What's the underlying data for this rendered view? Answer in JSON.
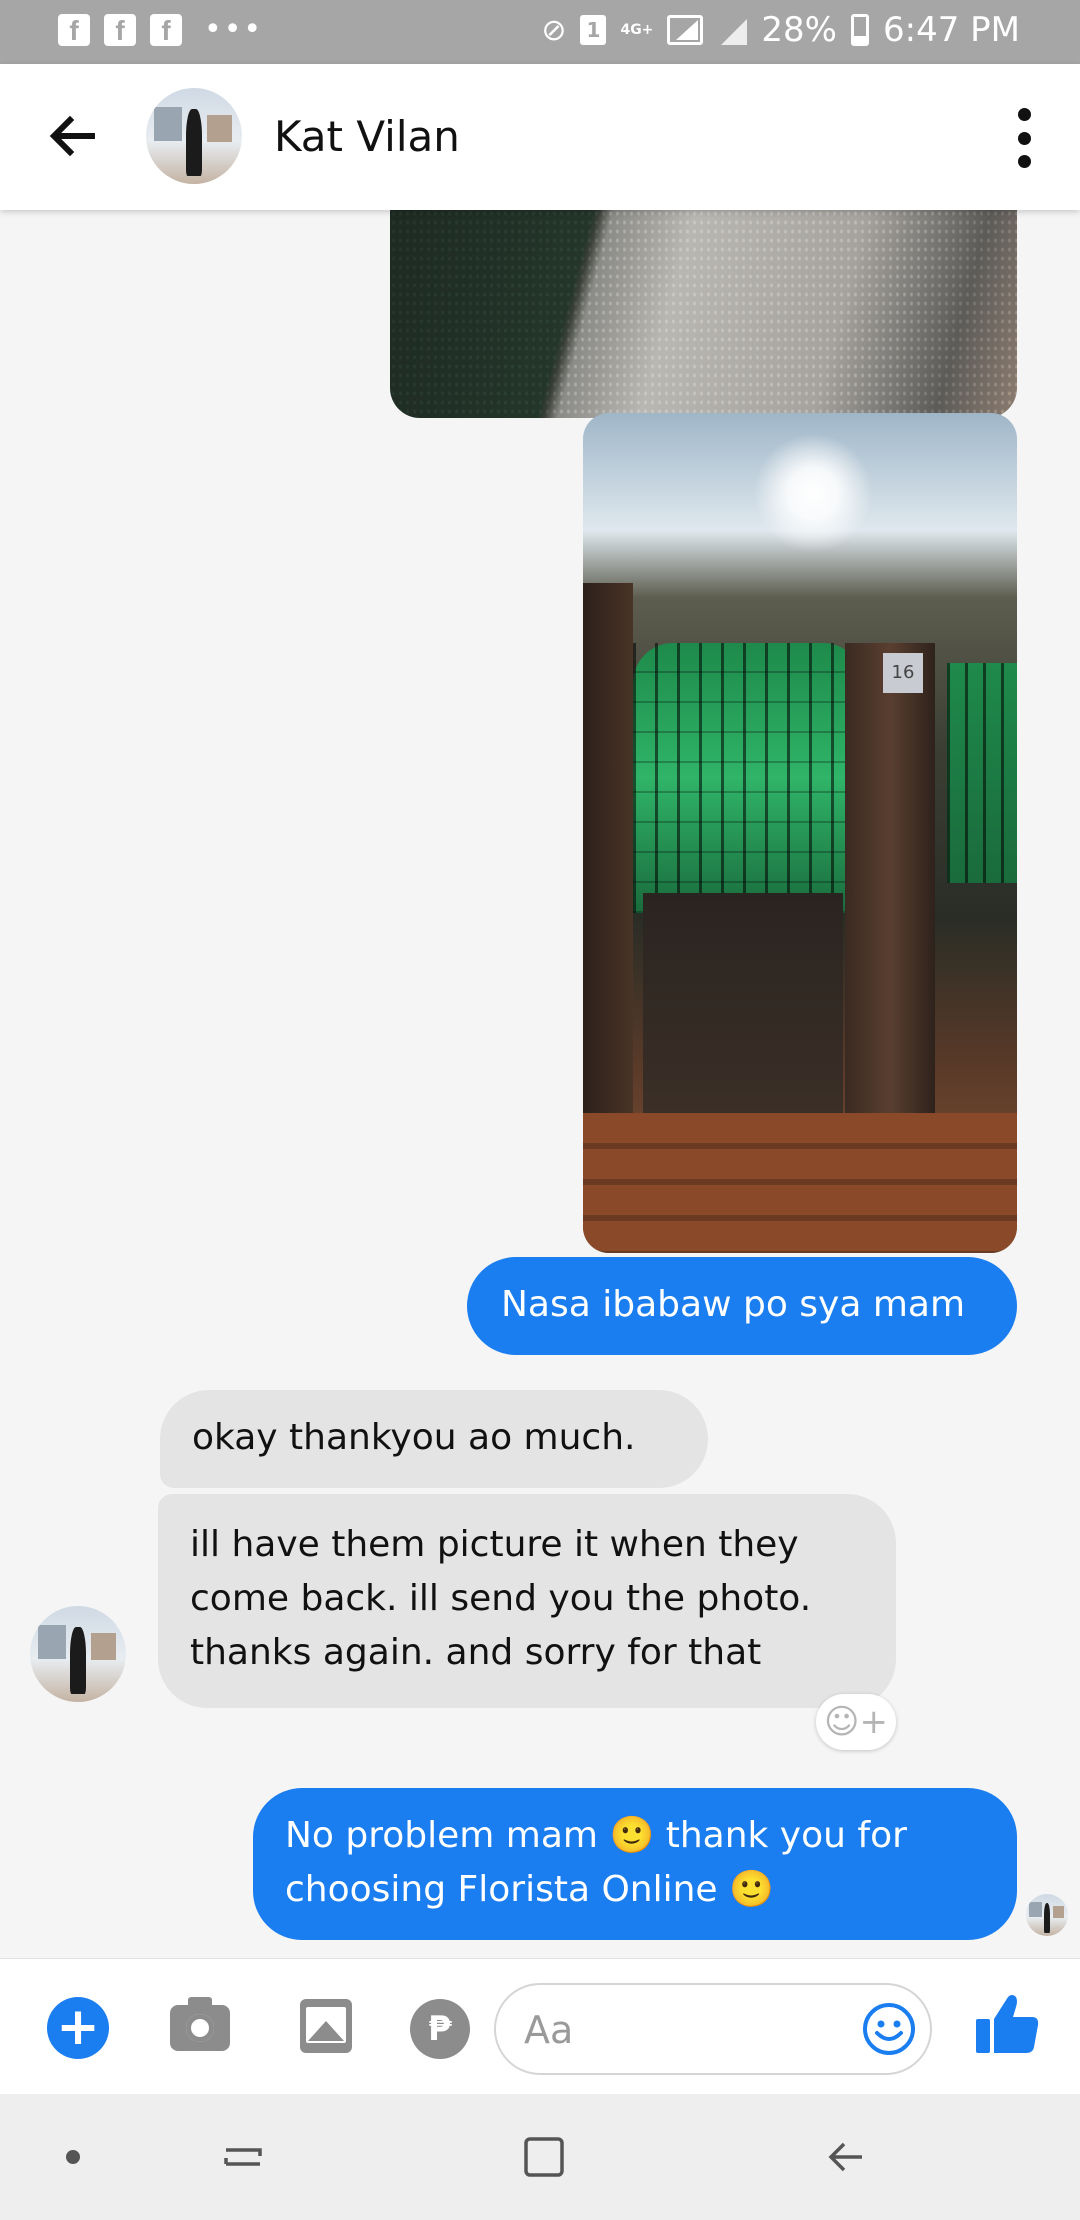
{
  "status_bar": {
    "app_icons": [
      "f",
      "f",
      "f"
    ],
    "overflow": "•••",
    "sim": "1",
    "network": "4G+",
    "battery": "28%",
    "time": "6:47 PM"
  },
  "header": {
    "contact_name": "Kat Vilan"
  },
  "gate_photo": {
    "house_number": "16"
  },
  "messages": {
    "out_1": "Nasa ibabaw po sya mam",
    "in_1": "okay thankyou ao much.",
    "in_2_lines": [
      "ill have them picture it when they",
      "come back. ill send you the photo.",
      "thanks again. and sorry for that"
    ],
    "out_2_lines": [
      "No problem mam 🙂 thank you for",
      "choosing Florista Online 🙂"
    ]
  },
  "reaction_button": {
    "label": "☺+"
  },
  "composer": {
    "placeholder": "Aa",
    "peso_symbol": "₱",
    "plus_symbol": "+"
  },
  "icons": {
    "back": "back-arrow-icon",
    "more": "more-vertical-icon",
    "camera": "camera-icon",
    "gallery": "gallery-icon",
    "payment": "peso-icon",
    "emoji": "smiley-icon",
    "like": "thumbs-up-icon"
  },
  "colors": {
    "accent": "#1a7df0",
    "incoming_bubble": "#e4e4e4",
    "status_bar": "#a6a6a6"
  }
}
